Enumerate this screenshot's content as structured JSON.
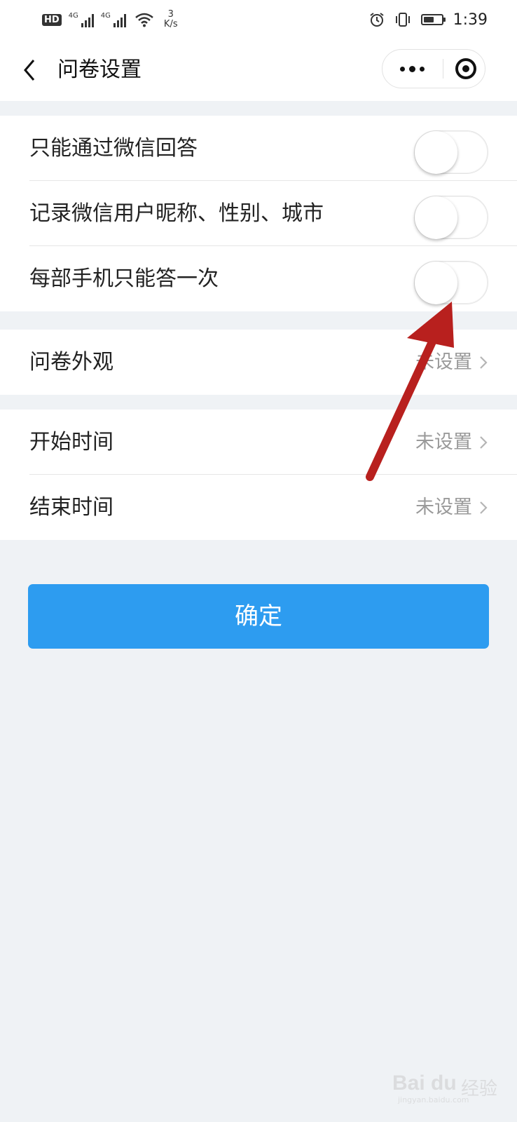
{
  "status_bar": {
    "hd": "HD",
    "sim1": "4G",
    "sim2": "4G",
    "speed_value": "3",
    "speed_unit": "K/s",
    "battery_level": 0.6,
    "time": "1:39"
  },
  "nav": {
    "title": "问卷设置"
  },
  "group_switches": {
    "items": [
      {
        "label": "只能通过微信回答",
        "on": false
      },
      {
        "label": "记录微信用户昵称、性别、城市",
        "on": false
      },
      {
        "label": "每部手机只能答一次",
        "on": false
      }
    ]
  },
  "group_appearance": {
    "label": "问卷外观",
    "value": "未设置"
  },
  "group_time": {
    "start": {
      "label": "开始时间",
      "value": "未设置"
    },
    "end": {
      "label": "结束时间",
      "value": "未设置"
    }
  },
  "confirm_label": "确定",
  "colors": {
    "primary": "#2d9cf0",
    "background": "#eff2f5",
    "annotation_arrow": "#b8201e"
  },
  "watermark": {
    "logo": "Bai du",
    "sub": "经验",
    "url": "jingyan.baidu.com"
  }
}
